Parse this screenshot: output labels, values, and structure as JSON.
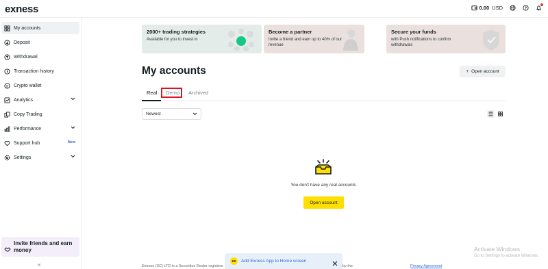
{
  "topbar": {
    "logo": "exness",
    "balance": "0.00",
    "currency": "USD"
  },
  "sidebar": {
    "items": [
      {
        "label": "My accounts",
        "icon": "accounts-icon"
      },
      {
        "label": "Deposit",
        "icon": "deposit-icon"
      },
      {
        "label": "Withdrawal",
        "icon": "withdrawal-icon"
      },
      {
        "label": "Transaction history",
        "icon": "history-icon"
      },
      {
        "label": "Crypto wallet",
        "icon": "wallet-icon"
      },
      {
        "label": "Analytics",
        "icon": "analytics-icon"
      },
      {
        "label": "Copy Trading",
        "icon": "copy-trading-icon"
      },
      {
        "label": "Performance",
        "icon": "performance-icon"
      },
      {
        "label": "Support hub",
        "icon": "support-icon",
        "badge": "New"
      },
      {
        "label": "Settings",
        "icon": "settings-icon"
      }
    ],
    "invite": "Invite friends and earn money",
    "collapse": "«"
  },
  "promos": [
    {
      "title": "2000+ trading strategies",
      "subtitle": "Available for you to invest in",
      "bg": "#e3ece8"
    },
    {
      "title": "Become a partner",
      "subtitle": "Invite a friend and earn up to 40% of our revenue",
      "bg": "#eae1df"
    },
    {
      "title": "Secure your funds",
      "subtitle": "with Push notifications to confirm withdrawals",
      "bg": "#eae1df"
    }
  ],
  "main": {
    "title": "My accounts",
    "open_account_top": "Open account",
    "tabs": [
      "Real",
      "Demo",
      "Archived"
    ],
    "sort": "Newest",
    "empty_text": "You don't have any real accounts",
    "open_account": "Open account"
  },
  "footer": {
    "text": "Exness (SC) LTD is a Securities Dealer registere",
    "by": "by the",
    "link": "Privacy Agreement"
  },
  "banner": {
    "logo": "ex",
    "text": "Add Exness App to Home screen"
  },
  "watermark": {
    "line1": "Activate Windows",
    "line2": "Go to Settings to activate Windows."
  },
  "colors": {
    "accent": "#ffde02",
    "link": "#2f6bdc",
    "highlight": "#e0141e"
  }
}
